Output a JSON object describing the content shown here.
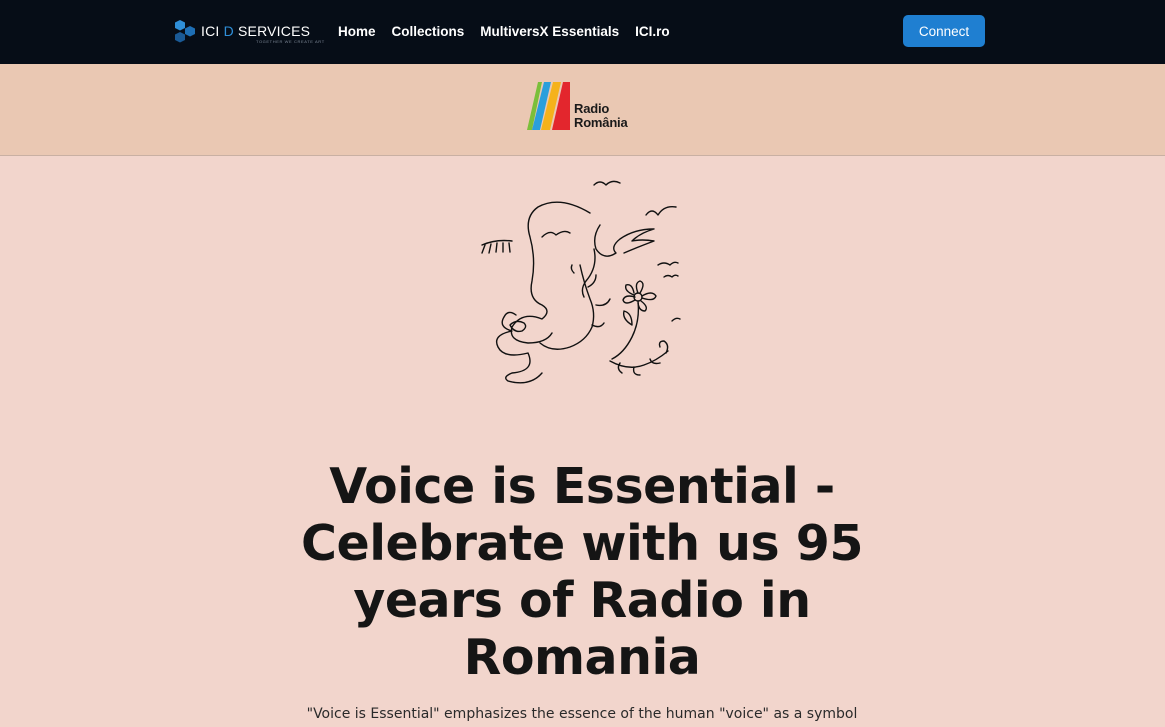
{
  "brand": {
    "name_part1": "ICI ",
    "name_d": "D",
    "name_part2": " SERVICES",
    "tagline": "TOGETHER WE CREATE ART",
    "accent_color": "#2f8fd8"
  },
  "nav": {
    "links": [
      "Home",
      "Collections",
      "MultiversX Essentials",
      "ICI.ro"
    ],
    "connect_label": "Connect",
    "connect_color": "#1f7fd1"
  },
  "partner_logo": {
    "line1": "Radio",
    "line2": "România",
    "icon": "radio-romania-stripes-icon"
  },
  "hero": {
    "illustration": "line-art-face-birds-flower-icon",
    "title": "Voice is Essential - Celebrate with us 95 years of Radio in Romania",
    "text": "\"Voice is Essential\" emphasizes the essence of the human \"voice\" as a symbol"
  },
  "colors": {
    "navbar": "#060d17",
    "logo_band": "#eac8b3",
    "page_background": "#f2d5cc"
  }
}
